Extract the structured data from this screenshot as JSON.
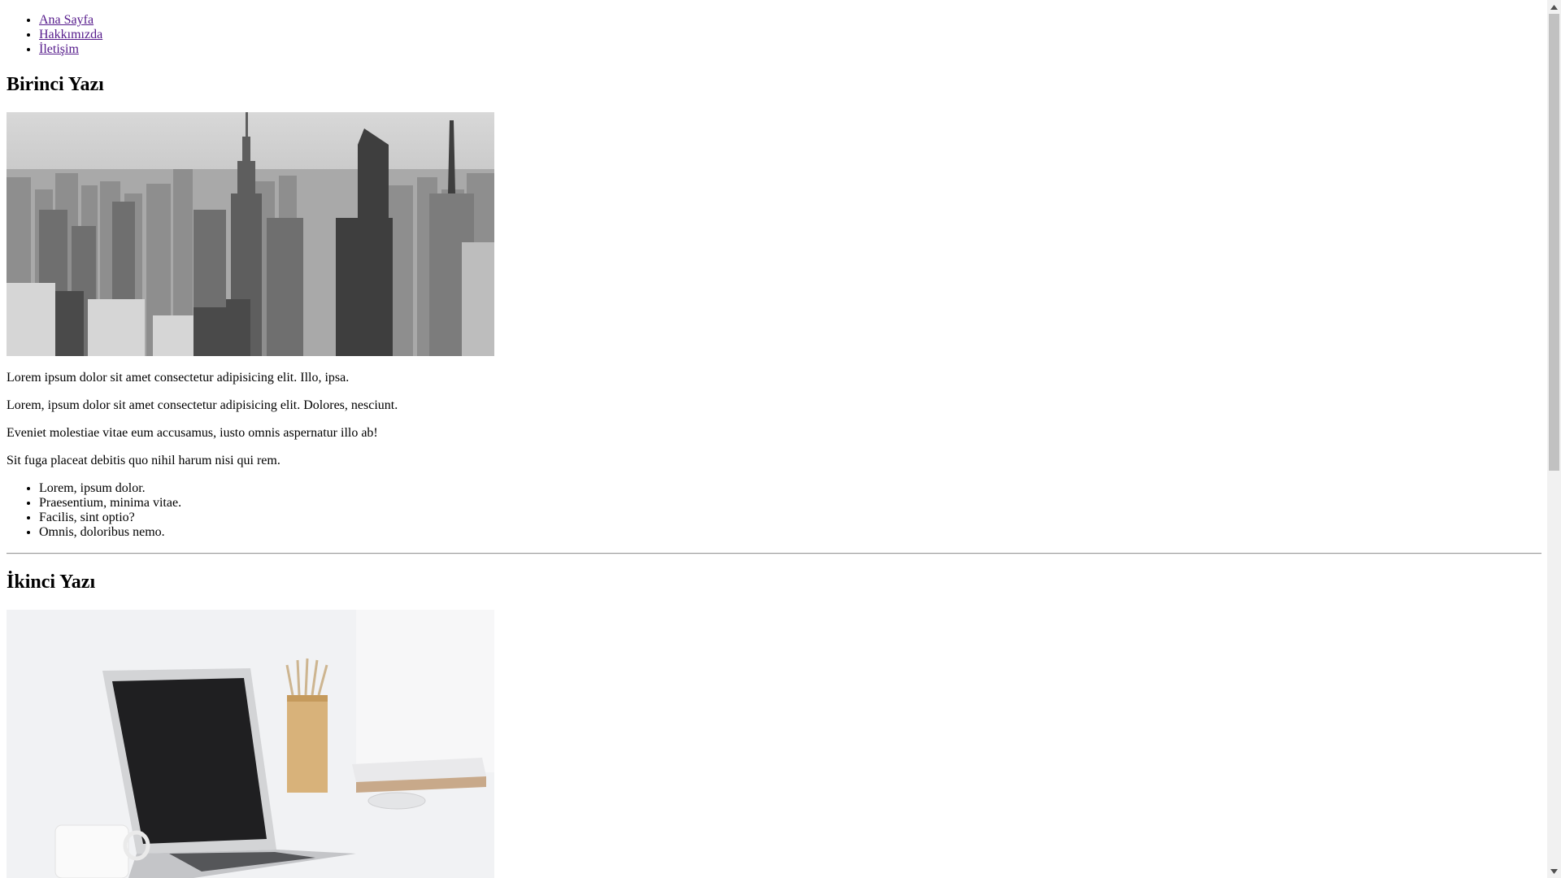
{
  "nav": {
    "items": [
      {
        "label": "Ana Sayfa"
      },
      {
        "label": "Hakkımızda"
      },
      {
        "label": "İletişim"
      }
    ]
  },
  "posts": [
    {
      "title": "Birinci Yazı",
      "image": "city-skyline-photo",
      "paragraphs": [
        "Lorem ipsum dolor sit amet consectetur adipisicing elit. Illo, ipsa.",
        "Lorem, ipsum dolor sit amet consectetur adipisicing elit. Dolores, nesciunt.",
        "Eveniet molestiae vitae eum accusamus, iusto omnis aspernatur illo ab!",
        "Sit fuga placeat debitis quo nihil harum nisi qui rem."
      ],
      "list": [
        "Lorem, ipsum dolor.",
        "Praesentium, minima vitae.",
        "Facilis, sint optio?",
        "Omnis, doloribus nemo."
      ]
    },
    {
      "title": "İkinci Yazı",
      "image": "laptop-desk-photo"
    }
  ],
  "colors": {
    "visited_link": "#551a8b",
    "scrollbar_track": "#f1f1f1",
    "scrollbar_thumb": "#c1c1c1"
  }
}
